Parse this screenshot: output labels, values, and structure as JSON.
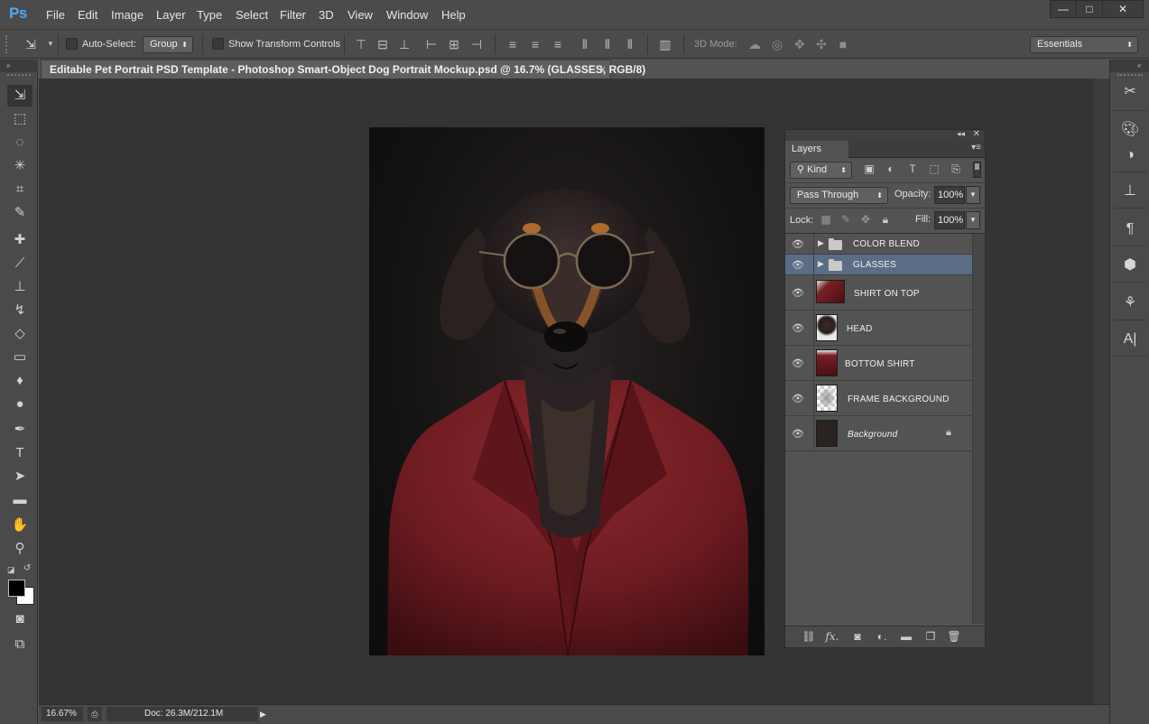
{
  "app": {
    "logo": "Ps"
  },
  "menu": [
    "File",
    "Edit",
    "Image",
    "Layer",
    "Type",
    "Select",
    "Filter",
    "3D",
    "View",
    "Window",
    "Help"
  ],
  "window_controls": {
    "minimize": "—",
    "maximize": "□",
    "close": "✕"
  },
  "options_bar": {
    "auto_select_label": "Auto-Select:",
    "auto_select_value": "Group",
    "show_transform_label": "Show Transform Controls",
    "mode_3d_label": "3D Mode:",
    "workspace": "Essentials"
  },
  "document": {
    "tab_title": "Editable Pet Portrait PSD Template -  Photoshop Smart-Object Dog Portrait Mockup.psd @ 16.7% (GLASSES, RGB/8)",
    "close_symbol": "×"
  },
  "layers_panel": {
    "tab_label": "Layers",
    "filter_kind": "Kind",
    "blend_mode": "Pass Through",
    "opacity_label": "Opacity:",
    "opacity_value": "100%",
    "lock_label": "Lock:",
    "fill_label": "Fill:",
    "fill_value": "100%",
    "layers": [
      {
        "name": "COLOR BLEND",
        "type": "group",
        "selected": false
      },
      {
        "name": "GLASSES",
        "type": "group",
        "selected": true
      },
      {
        "name": "SHIRT ON TOP",
        "type": "layer",
        "selected": false
      },
      {
        "name": "HEAD",
        "type": "layer",
        "selected": false
      },
      {
        "name": "BOTTOM SHIRT",
        "type": "layer",
        "selected": false
      },
      {
        "name": "FRAME BACKGROUND",
        "type": "layer",
        "selected": false
      },
      {
        "name": "Background",
        "type": "background",
        "selected": false,
        "locked": true
      }
    ],
    "footer_icons": [
      "link-icon",
      "fx-icon",
      "mask-icon",
      "adjustment-icon",
      "folder-icon",
      "new-layer-icon",
      "trash-icon"
    ],
    "fx_text": "fx"
  },
  "status": {
    "zoom": "16.67%",
    "doc_size": "Doc: 26.3M/212.1M"
  },
  "colors": {
    "selection": "#5b6d85",
    "suit": "#7a1f26",
    "logo": "#4ea7ff"
  }
}
